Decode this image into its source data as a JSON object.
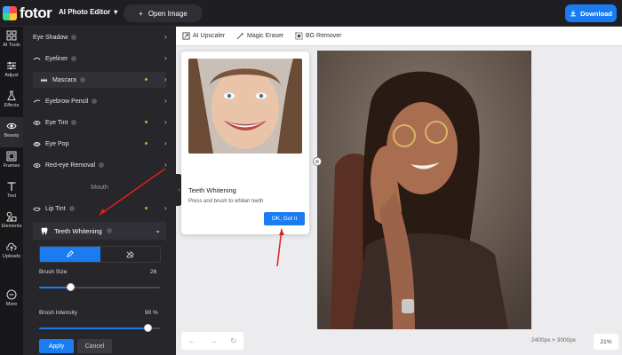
{
  "app": {
    "logo_text": "fotor",
    "editor_menu": "AI Photo Editor",
    "open_image": "Open Image",
    "download": "Download"
  },
  "rail": [
    {
      "label": "AI Tools",
      "icon": "grid-icon"
    },
    {
      "label": "Adjust",
      "icon": "sliders-icon"
    },
    {
      "label": "Effects",
      "icon": "flask-icon"
    },
    {
      "label": "Beauty",
      "icon": "eye-icon",
      "active": true
    },
    {
      "label": "Frames",
      "icon": "frame-icon"
    },
    {
      "label": "Text",
      "icon": "text-icon"
    },
    {
      "label": "Elements",
      "icon": "shapes-icon"
    },
    {
      "label": "Uploads",
      "icon": "cloud-upload-icon"
    },
    {
      "label": "More",
      "icon": "more-icon"
    }
  ],
  "panel": {
    "items": [
      {
        "label": "Eye Shadow"
      },
      {
        "label": "Eyeliner"
      },
      {
        "label": "Mascara",
        "dot": true
      },
      {
        "label": "Eyebrow Pencil"
      },
      {
        "label": "Eye Tint",
        "dot": true
      },
      {
        "label": "Eye Pop",
        "dot": true
      },
      {
        "label": "Red-eye Removal"
      }
    ],
    "section": "Mouth",
    "lip_tint": "Lip Tint",
    "teeth_whitening": "Teeth Whitening",
    "brush_size_label": "Brush Size",
    "brush_size_value": "26",
    "brush_size_fraction": 0.26,
    "brush_intensity_label": "Brush Intensity",
    "brush_intensity_value": "90 %",
    "brush_intensity_fraction": 0.9,
    "apply": "Apply",
    "cancel": "Cancel"
  },
  "toolbar": {
    "ai_upscaler": "AI Upscaler",
    "magic_eraser": "Magic Eraser",
    "bg_remover": "BG Remover"
  },
  "tip": {
    "title": "Teeth Whitening",
    "description": "Press and brush to whiten teeth",
    "ok": "OK, Got it"
  },
  "canvas": {
    "dimensions": "2400px × 3000px",
    "zoom": "21%"
  },
  "colors": {
    "accent": "#1a7cf0",
    "panel_bg": "#26262b",
    "workspace_bg": "#ececee",
    "annotation_arrow": "#e02020"
  }
}
